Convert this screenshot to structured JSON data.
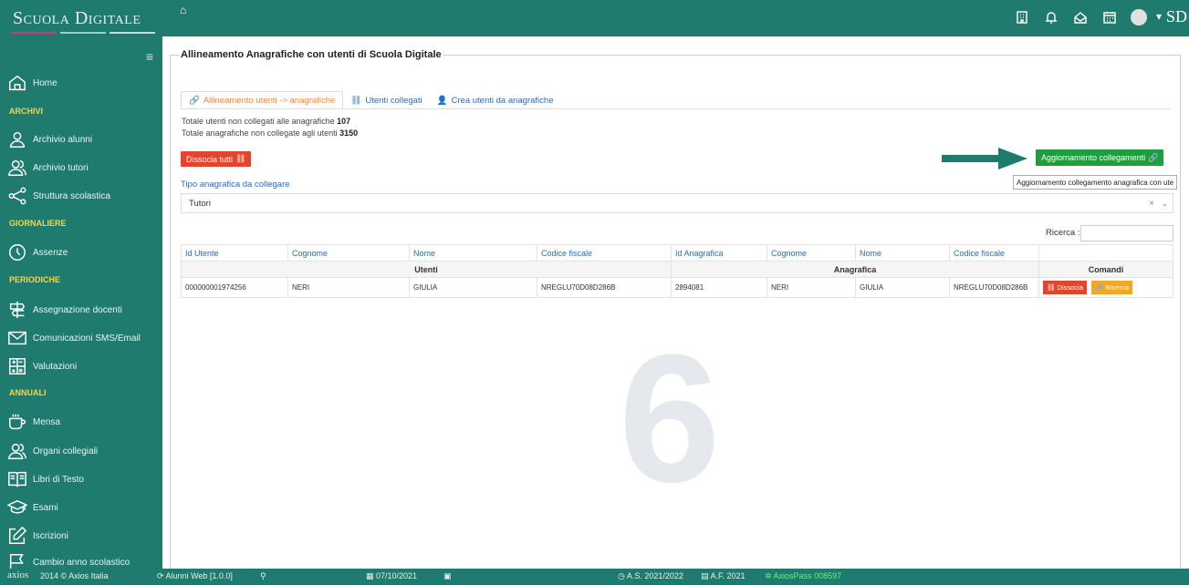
{
  "brand": {
    "name": "Scuola Digitale",
    "short": "SD"
  },
  "topbar": {
    "home_glyph": "⌂",
    "icons": [
      "building-icon",
      "bell-icon",
      "inbox-icon",
      "calendar-icon"
    ]
  },
  "sidebar": {
    "home": "Home",
    "sections": {
      "archivi": "ARCHIVI",
      "giornaliere": "GIORNALIERE",
      "periodiche": "PERIODICHE",
      "annuali": "ANNUALI"
    },
    "items": {
      "archivio_alunni": "Archivio alunni",
      "archivio_tutori": "Archivio tutori",
      "struttura": "Struttura scolastica",
      "assenze": "Assenze",
      "assegnazione": "Assegnazione docenti",
      "comunicazioni": "Comunicazioni SMS/Email",
      "valutazioni": "Valutazioni",
      "mensa": "Mensa",
      "organi": "Organi collegiali",
      "libri": "Libri di Testo",
      "esami": "Esami",
      "iscrizioni": "Iscrizioni",
      "cambio": "Cambio anno scolastico"
    }
  },
  "main": {
    "title": "Allineamento Anagrafiche con utenti di Scuola Digitale",
    "tabs": [
      "Allineamento utenti -> anagrafiche",
      "Utenti collegati",
      "Crea utenti da anagrafiche"
    ],
    "info1_label": "Totale utenti non collegati alle anagrafiche",
    "info1_value": "107",
    "info2_label": "Totale anagrafiche non collegate agli utenti",
    "info2_value": "3150",
    "dissocia_all": "Dissocia tutti",
    "update_links": "Aggiornamento collegamenti",
    "tooltip": "Aggiornamento collegamento anagrafica con ute",
    "type_label": "Tipo anagrafica da collegare",
    "type_value": "Tutori",
    "search_label": "Ricerca :",
    "columns": [
      "Id Utente",
      "Cognome",
      "Nome",
      "Codice fiscale",
      "Id Anagrafica",
      "Cognome",
      "Nome",
      "Codice fiscale"
    ],
    "group_utenti": "Utenti",
    "group_anagrafica": "Anagrafica",
    "group_comandi": "Comandi",
    "row": [
      "000000001974256",
      "NERI",
      "GIULIA",
      "NREGLU70D08D286B",
      "2894081",
      "NERI",
      "GIULIA",
      "NREGLU70D08D286B"
    ],
    "btn_dissocia": "Dissocia",
    "btn_ricerca": "Ricerca",
    "big_number": "6"
  },
  "status": {
    "copyright": "2014 © Axios Italia",
    "app": "Alunni Web [1.0.0]",
    "date": "07/10/2021",
    "as": "A.S. 2021/2022",
    "af": "A.F. 2021",
    "pass": "AxiosPass 008597",
    "logo": "axios"
  }
}
